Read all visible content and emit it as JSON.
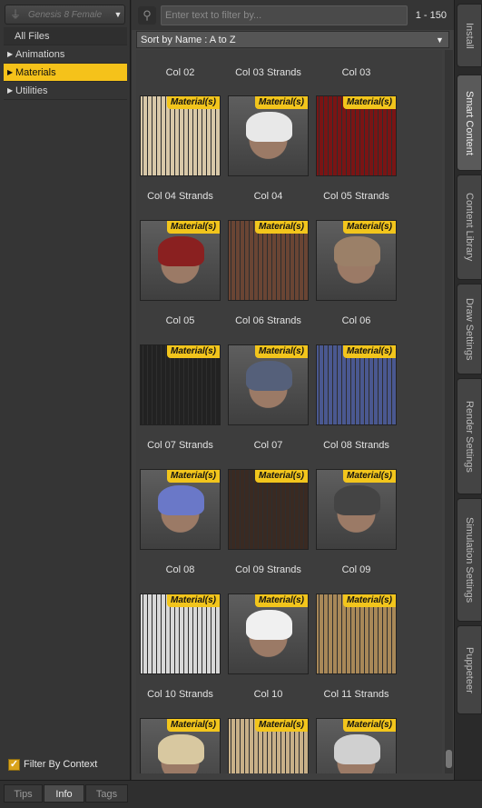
{
  "left_panel": {
    "figure_select": "Genesis 8 Female",
    "tree": {
      "root": "All Files",
      "items": [
        {
          "label": "Animations",
          "selected": false
        },
        {
          "label": "Materials",
          "selected": true
        },
        {
          "label": "Utilities",
          "selected": false
        }
      ]
    },
    "filter_by_context": {
      "label": "Filter By Context",
      "checked": true
    }
  },
  "center_panel": {
    "search_placeholder": "Enter text to filter by...",
    "result_count": "1 - 150",
    "sort_label": "Sort by Name : A to Z",
    "badge_label": "Material(s)",
    "grid": {
      "label_rows": [
        [
          "Col 02",
          "Col 03 Strands",
          "Col 03"
        ],
        [
          "Col 04 Strands",
          "Col 04",
          "Col 05 Strands"
        ],
        [
          "Col 05",
          "Col 06 Strands",
          "Col 06"
        ],
        [
          "Col 07 Strands",
          "Col 07",
          "Col 08 Strands"
        ],
        [
          "Col 08",
          "Col 09 Strands",
          "Col 09"
        ],
        [
          "Col 10 Strands",
          "Col 10",
          "Col 11 Strands"
        ]
      ],
      "thumb_rows": [
        [
          {
            "type": "swatch",
            "color": "#d8c8a8"
          },
          {
            "type": "portrait",
            "color": "#e8e8e8"
          },
          {
            "type": "swatch",
            "color": "#7a1414"
          }
        ],
        [
          {
            "type": "portrait",
            "color": "#8a2020"
          },
          {
            "type": "swatch",
            "color": "#6a4534"
          },
          {
            "type": "portrait",
            "color": "#9b8068"
          }
        ],
        [
          {
            "type": "swatch",
            "color": "#222222"
          },
          {
            "type": "portrait",
            "color": "#55607a"
          },
          {
            "type": "swatch",
            "color": "#4a5890"
          }
        ],
        [
          {
            "type": "portrait",
            "color": "#6a78c8"
          },
          {
            "type": "swatch",
            "color": "#3a2a22"
          },
          {
            "type": "portrait",
            "color": "#444444"
          }
        ],
        [
          {
            "type": "swatch",
            "color": "#d8d8d8"
          },
          {
            "type": "portrait",
            "color": "#f0f0f0"
          },
          {
            "type": "swatch",
            "color": "#a88858"
          }
        ],
        [
          {
            "type": "portrait",
            "color": "#d8c8a0"
          },
          {
            "type": "swatch",
            "color": "#c8b088"
          },
          {
            "type": "portrait",
            "color": "#d0d0d0"
          }
        ]
      ]
    }
  },
  "right_tabs": [
    {
      "label": "Install",
      "active": false
    },
    {
      "label": "Smart Content",
      "active": true
    },
    {
      "label": "Content Library",
      "active": false
    },
    {
      "label": "Draw Settings",
      "active": false
    },
    {
      "label": "Render Settings",
      "active": false
    },
    {
      "label": "Simulation Settings",
      "active": false
    },
    {
      "label": "Puppeteer",
      "active": false
    }
  ],
  "bottom_tabs": [
    {
      "label": "Tips",
      "active": false
    },
    {
      "label": "Info",
      "active": true
    },
    {
      "label": "Tags",
      "active": false
    }
  ],
  "colors": {
    "accent": "#f5c21a",
    "badge": "#f2c51c"
  }
}
